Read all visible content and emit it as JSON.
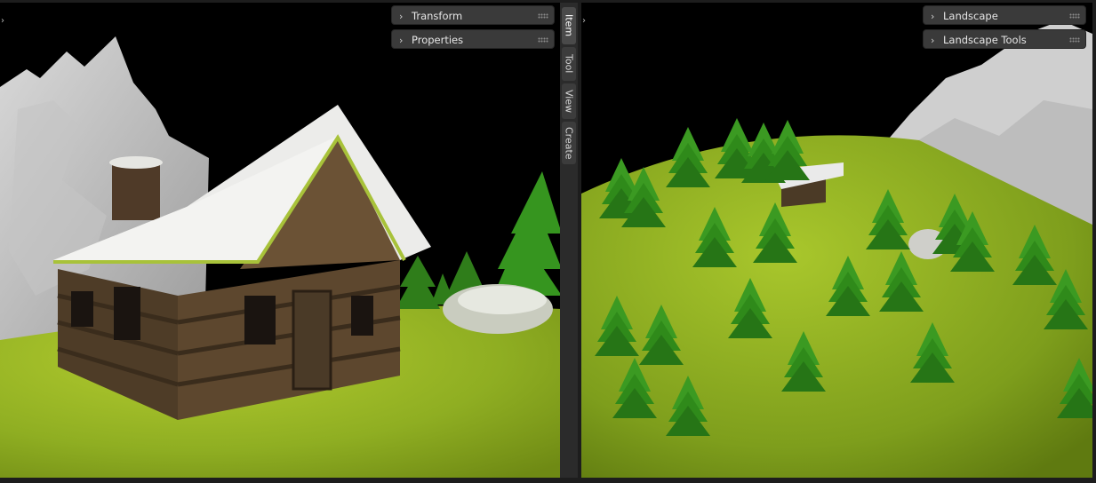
{
  "left_viewport": {
    "panels": [
      {
        "label": "Transform"
      },
      {
        "label": "Properties"
      }
    ],
    "scene_description_icons": [
      "cabin",
      "mountain",
      "pine-tree",
      "snow-rock"
    ]
  },
  "sidebar_tabs": [
    {
      "label": "Item",
      "active": true
    },
    {
      "label": "Tool",
      "active": false
    },
    {
      "label": "View",
      "active": false
    },
    {
      "label": "Create",
      "active": false
    }
  ],
  "right_viewport": {
    "panels": [
      {
        "label": "Landscape"
      },
      {
        "label": "Landscape Tools"
      }
    ]
  },
  "icons": {
    "chevron": "›",
    "toggle": "›"
  },
  "colors": {
    "grass": "#8fae2a",
    "pine": "#2f8a1e",
    "snow": "#e8e8e4",
    "log": "#5a4530",
    "panel_bg": "#3a3a3a"
  }
}
